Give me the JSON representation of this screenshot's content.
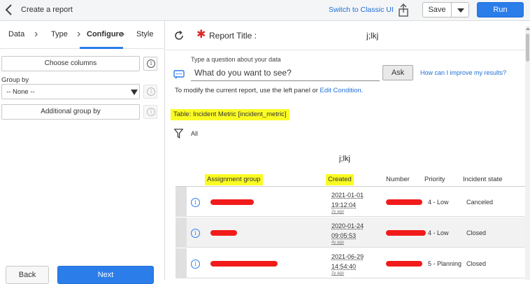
{
  "header": {
    "title": "Create a report",
    "classic_link": "Switch to Classic UI",
    "save_label": "Save",
    "run_label": "Run"
  },
  "steps": [
    "Data",
    "Type",
    "Configure",
    "Style"
  ],
  "active_step": "Configure",
  "config": {
    "choose_columns": "Choose columns",
    "group_by_label": "Group by",
    "group_by_value": "-- None --",
    "additional_group_by": "Additional group by"
  },
  "footer": {
    "back_label": "Back",
    "next_label": "Next"
  },
  "report": {
    "title_label": "Report Title :",
    "title_value": "j;lkj",
    "nlq_hint": "Type a question about your data",
    "nlq_placeholder": "What do you want to see?",
    "ask_label": "Ask",
    "improve_link": "How can I improve my results?",
    "modify_text": "To modify the current report, use the left panel or",
    "edit_condition": "Edit Condition.",
    "table_label": "Table: Incident Metric [incident_metric]",
    "filter_text": "All",
    "report_name": "j;lkj"
  },
  "table": {
    "columns": [
      "Assignment group",
      "Created",
      "Number",
      "Priority",
      "Incident state"
    ],
    "rows": [
      {
        "created_date": "2021-01-01",
        "created_time": "19:12:04",
        "ago": "2y ago",
        "priority": "4 - Low",
        "state": "Canceled"
      },
      {
        "created_date": "2020-01-24",
        "created_time": "09:05:53",
        "ago": "4y ago",
        "priority": "4 - Low",
        "state": "Closed"
      },
      {
        "created_date": "2021-06-29",
        "created_time": "14:54:40",
        "ago": "2y ago",
        "priority": "5 - Planning",
        "state": "Closed"
      }
    ]
  },
  "colors": {
    "accent": "#2b7de9",
    "highlight": "#fbfb24",
    "redaction": "#f21b1b",
    "required": "#d92b2b"
  }
}
